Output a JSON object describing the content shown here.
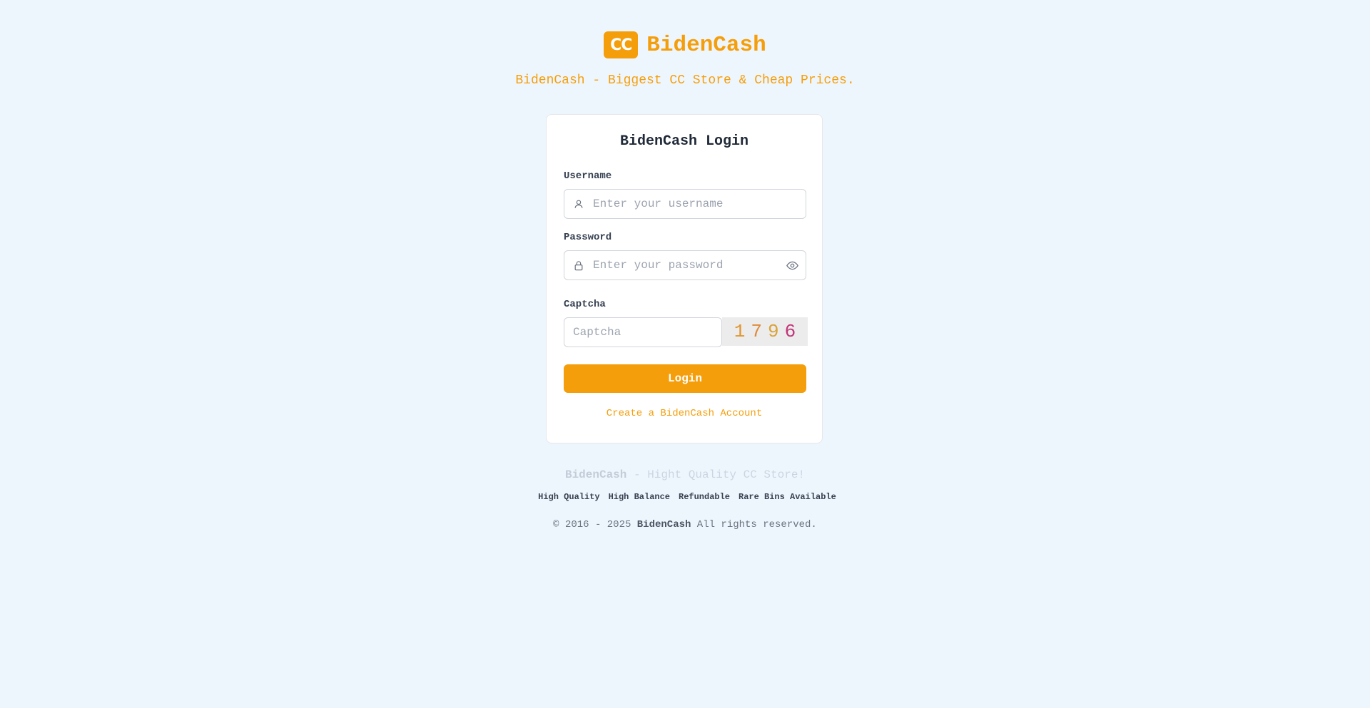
{
  "brand": {
    "badge": "CC",
    "name": "BidenCash",
    "tagline": "BidenCash - Biggest CC Store & Cheap Prices."
  },
  "login_card": {
    "title": "BidenCash Login",
    "username": {
      "label": "Username",
      "placeholder": "Enter your username",
      "value": ""
    },
    "password": {
      "label": "Password",
      "placeholder": "Enter your password",
      "value": ""
    },
    "captcha": {
      "label": "Captcha",
      "placeholder": "Captcha",
      "value": "",
      "digits": [
        {
          "char": "1",
          "color": "#e0952e"
        },
        {
          "char": "7",
          "color": "#df8a3a"
        },
        {
          "char": "9",
          "color": "#d9a33a"
        },
        {
          "char": "6",
          "color": "#c2357a"
        }
      ]
    },
    "login_button": "Login",
    "create_account_link": "Create a BidenCash Account"
  },
  "footer": {
    "brand_name": "BidenCash",
    "brand_tagline": " - Hight Quality CC Store!",
    "features": [
      {
        "icon": "",
        "label": "High Quality"
      },
      {
        "icon": "",
        "label": "High Balance"
      },
      {
        "icon": "",
        "label": "Refundable"
      },
      {
        "icon": "",
        "label": "Rare Bins Available"
      }
    ],
    "copyright_prefix": "© 2016 - 2025 ",
    "copyright_brand": "BidenCash",
    "copyright_suffix": " All rights reserved."
  },
  "colors": {
    "accent": "#f59e0b",
    "background": "#eef6fd"
  }
}
